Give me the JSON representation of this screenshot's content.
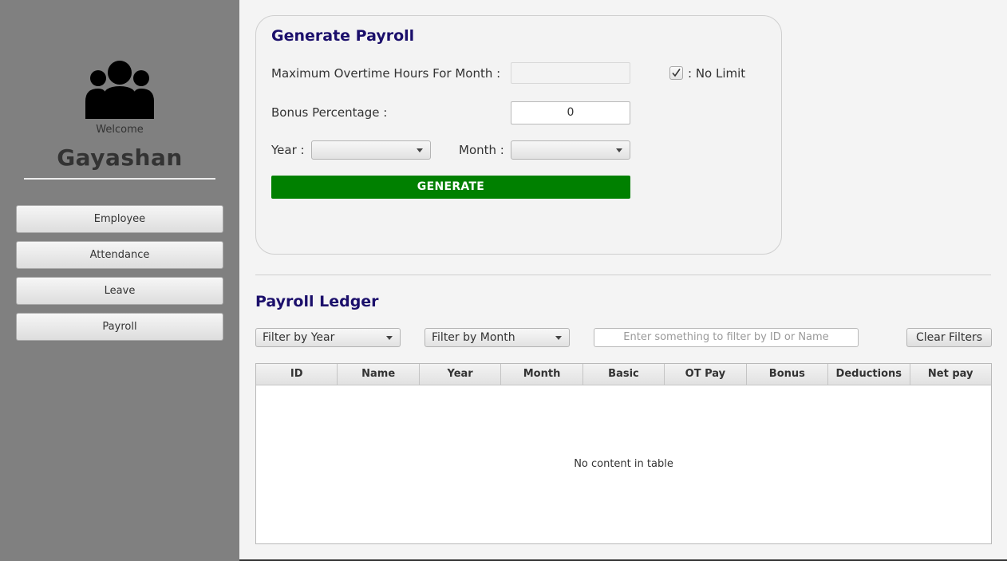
{
  "sidebar": {
    "welcome": "Welcome",
    "username": "Gayashan",
    "avatar_icon": "users-group-icon",
    "nav": [
      {
        "label": "Employee"
      },
      {
        "label": "Attendance"
      },
      {
        "label": "Leave"
      },
      {
        "label": "Payroll"
      }
    ]
  },
  "generate_payroll": {
    "title": "Generate Payroll",
    "max_ot_label": "Maximum Overtime Hours For Month :",
    "max_ot_value": "",
    "no_limit_label": ": No Limit",
    "no_limit_checked": true,
    "bonus_label": "Bonus Percentage :",
    "bonus_value": "0",
    "year_label": "Year :",
    "year_value": "",
    "month_label": "Month :",
    "month_value": "",
    "generate_button": "GENERATE"
  },
  "ledger": {
    "title": "Payroll Ledger",
    "filter_year": "Filter by Year",
    "filter_month": "Filter by Month",
    "search_placeholder": "Enter something to filter by ID or Name",
    "clear_button": "Clear Filters",
    "columns": [
      "ID",
      "Name",
      "Year",
      "Month",
      "Basic",
      "OT Pay",
      "Bonus",
      "Deductions",
      "Net pay"
    ],
    "rows": [],
    "empty_message": "No content in table"
  },
  "colors": {
    "sidebar_bg": "#808080",
    "heading": "#1b0f6b",
    "generate_button_bg": "#008000"
  }
}
